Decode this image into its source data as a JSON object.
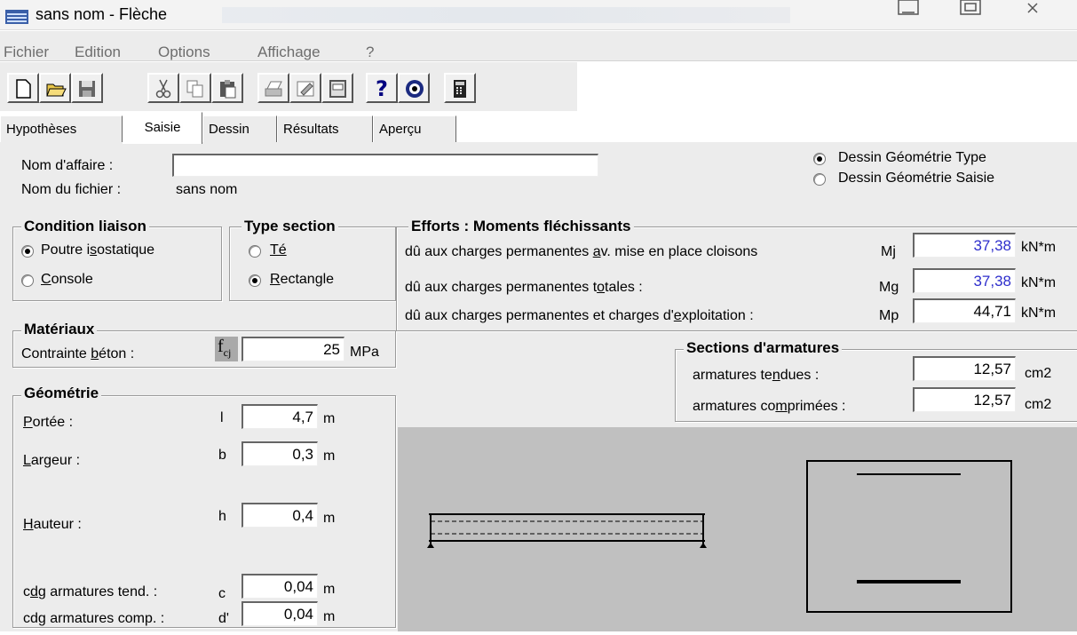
{
  "window": {
    "title": "sans nom - Flèche"
  },
  "menu": [
    "Fichier",
    "Edition",
    "Options",
    "Affichage",
    "?"
  ],
  "toolbar": {
    "buttons": [
      "new-file",
      "open-folder",
      "save",
      "cut",
      "copy",
      "paste",
      "print",
      "properties",
      "page-setup",
      "help",
      "web",
      "calculator"
    ],
    "help_glyph": "?"
  },
  "tabs": [
    "Hypothèses",
    "Saisie",
    "Dessin",
    "Résultats",
    "Aperçu"
  ],
  "active_tab": "Saisie",
  "affaire": {
    "label": "Nom d'affaire :",
    "value": ""
  },
  "fichier": {
    "label": "Nom du fichier :",
    "value": "sans nom"
  },
  "dessin_options": {
    "type": "Dessin Géométrie Type",
    "saisie": "Dessin Géométrie Saisie",
    "selected": "type"
  },
  "condition_liaison": {
    "title": "Condition liaison",
    "opt1_a": "Poutre i",
    "opt1_u": "s",
    "opt1_b": "ostatique",
    "opt2_u": "C",
    "opt2_b": "onsole",
    "selected": "poutre"
  },
  "type_section": {
    "title": "Type section",
    "opt1": "Té",
    "opt2_u": "R",
    "opt2_b": "ectangle",
    "selected": "rectangle"
  },
  "materiaux": {
    "title": "Matériaux",
    "label_a": "Contrainte ",
    "label_u": "b",
    "label_b": "éton :",
    "symbol": "f",
    "symbol_sub": "cj",
    "value": "25",
    "unit": "MPa"
  },
  "geometrie": {
    "title": "Géométrie",
    "portee": {
      "label_u": "P",
      "label_b": "ortée :",
      "symbol": "l",
      "value": "4,7",
      "unit": "m"
    },
    "largeur": {
      "label_u": "L",
      "label_b": "argeur :",
      "symbol": "b",
      "value": "0,3",
      "unit": "m"
    },
    "hauteur": {
      "label_u": "H",
      "label_b": "auteur :",
      "symbol": "h",
      "value": "0,4",
      "unit": "m"
    },
    "cdg_tend": {
      "label_a": "c",
      "label_u": "d",
      "label_b": "g armatures tend. :",
      "symbol": "c",
      "value": "0,04",
      "unit": "m"
    },
    "cdg_comp": {
      "label_a": "cd",
      "label_u": "g",
      "label_b": " armatures comp. :",
      "symbol": "d'",
      "value": "0,04",
      "unit": "m"
    }
  },
  "efforts": {
    "title": "Efforts : Moments fléchissants",
    "rows": [
      {
        "label_a": "dû aux charges permanentes ",
        "label_u": "a",
        "label_b": "v. mise en place cloisons",
        "symbol": "Mj",
        "value": "37,38",
        "unit": "kN*m"
      },
      {
        "label_a": "dû aux charges permanentes t",
        "label_u": "o",
        "label_b": "tales :",
        "symbol": "Mg",
        "value": "37,38",
        "unit": "kN*m"
      },
      {
        "label_a": "dû aux charges permanentes et charges d'",
        "label_u": "e",
        "label_b": "xploitation :",
        "symbol": "Mp",
        "value": "44,71",
        "unit": "kN*m"
      }
    ]
  },
  "sections": {
    "title": "Sections d'armatures",
    "tendues": {
      "label_a": "armatures te",
      "label_u": "n",
      "label_b": "dues :",
      "value": "12,57",
      "unit": "cm2"
    },
    "comprimees": {
      "label_a": "armatures co",
      "label_u": "m",
      "label_b": "primées :",
      "value": "12,57",
      "unit": "cm2"
    }
  },
  "colors": {
    "computed_value": "#2e2ecc",
    "panel": "#ececec",
    "drawing_bg": "#c0c0c0"
  }
}
